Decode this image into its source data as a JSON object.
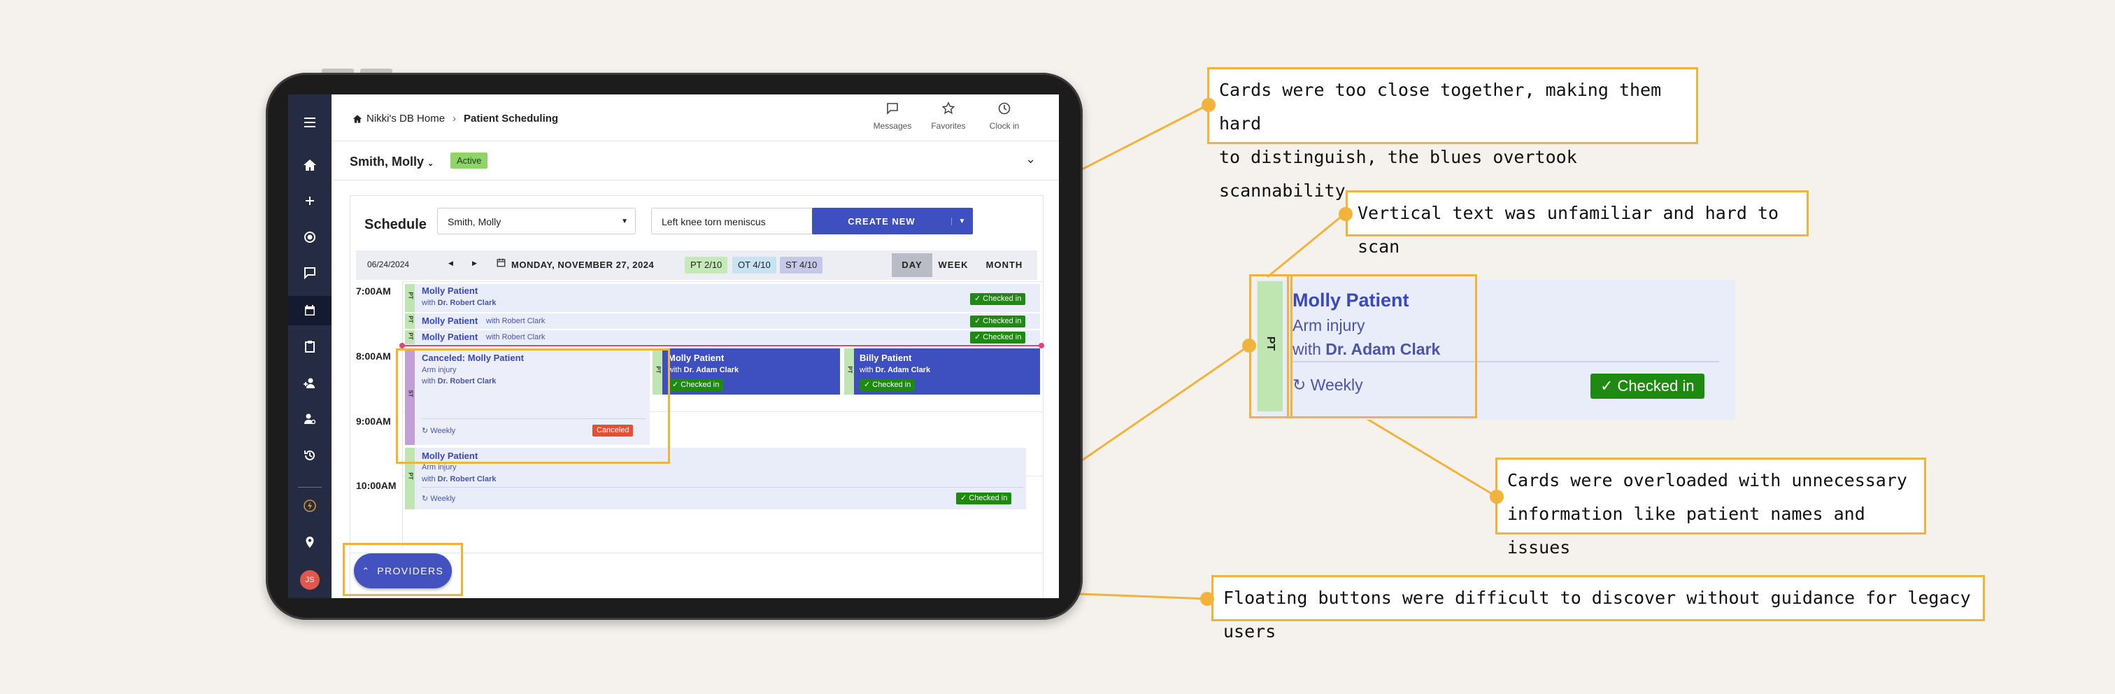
{
  "app": {
    "breadcrumb_home": "Nikki's DB Home",
    "breadcrumb_current": "Patient Scheduling",
    "top_actions": [
      {
        "label": "Messages",
        "icon": "chat-icon"
      },
      {
        "label": "Favorites",
        "icon": "star-icon"
      },
      {
        "label": "Clock in",
        "icon": "clock-icon"
      }
    ],
    "patient_name": "Smith, Molly",
    "status_badge": "Active",
    "sidebar_icons": [
      "menu-icon",
      "home-icon",
      "plus-icon",
      "record-icon",
      "comment-icon",
      "calendar-icon",
      "clipboard-icon",
      "add-person-icon",
      "user-cog-icon",
      "history-icon",
      "bolt-icon",
      "location-icon",
      "avatar"
    ],
    "avatar_initials": "JS",
    "brand_color": "#3e4fbf",
    "sidebar_color": "#252b43"
  },
  "schedule": {
    "title": "Schedule",
    "patient_select": "Smith, Molly",
    "condition_select": "Left knee torn meniscus",
    "create_button": "CREATE NEW",
    "date_field": "06/24/2024",
    "date_display": "MONDAY, NOVEMBER 27, 2024",
    "pills": [
      {
        "label": "PT 2/10",
        "color": "#c6e9b8"
      },
      {
        "label": "OT 4/10",
        "color": "#c8e4f4"
      },
      {
        "label": "ST 4/10",
        "color": "#c7c7e8"
      }
    ],
    "views": [
      "DAY",
      "WEEK",
      "MONTH"
    ],
    "active_view": "DAY",
    "times": [
      "7:00AM",
      "8:00AM",
      "9:00AM",
      "10:00AM"
    ],
    "appointments": [
      {
        "title": "Molly Patient",
        "with": "with",
        "doctor": "Dr. Robert Clark",
        "status": "Checked in",
        "type": "PT"
      },
      {
        "title": "Molly Patient",
        "with": "with Robert Clark",
        "status": "Checked in",
        "type": "PT"
      },
      {
        "title": "Molly Patient",
        "with": "with Robert Clark",
        "status": "Checked in",
        "type": "PT"
      },
      {
        "title": "Canceled: Molly Patient",
        "issue": "Arm injury",
        "with": "with",
        "doctor": "Dr. Robert Clark",
        "recurrence": "Weekly",
        "status": "Canceled",
        "type": "ST"
      },
      {
        "title": "Molly Patient",
        "with": "with",
        "doctor": "Dr. Adam Clark",
        "status": "Checked in",
        "type": "PT"
      },
      {
        "title": "Billy Patient",
        "with": "with",
        "doctor": "Dr. Adam Clark",
        "status": "Checked in",
        "type": "PT"
      },
      {
        "title": "Molly Patient",
        "issue": "Arm injury",
        "with": "with",
        "doctor": "Dr. Robert Clark",
        "recurrence": "Weekly",
        "status": "Checked in",
        "type": "PT"
      }
    ],
    "providers_button": "PROVIDERS"
  },
  "zoom_card": {
    "type": "PT",
    "title": "Molly Patient",
    "issue": "Arm injury",
    "with": "with",
    "doctor": "Dr. Adam Clark",
    "recurrence": "Weekly",
    "status": "Checked in"
  },
  "annotations": {
    "a1_line1": "Cards were too close together, making them hard",
    "a1_line2": "to distinguish, the blues overtook scannability",
    "a2": "Vertical text was unfamiliar and hard to scan",
    "a3_line1": "Cards were overloaded with unnecessary",
    "a3_line2": "information like patient names and issues",
    "a4": "Floating buttons were difficult to discover without guidance for legacy users",
    "accent_color": "#f2b33b"
  }
}
